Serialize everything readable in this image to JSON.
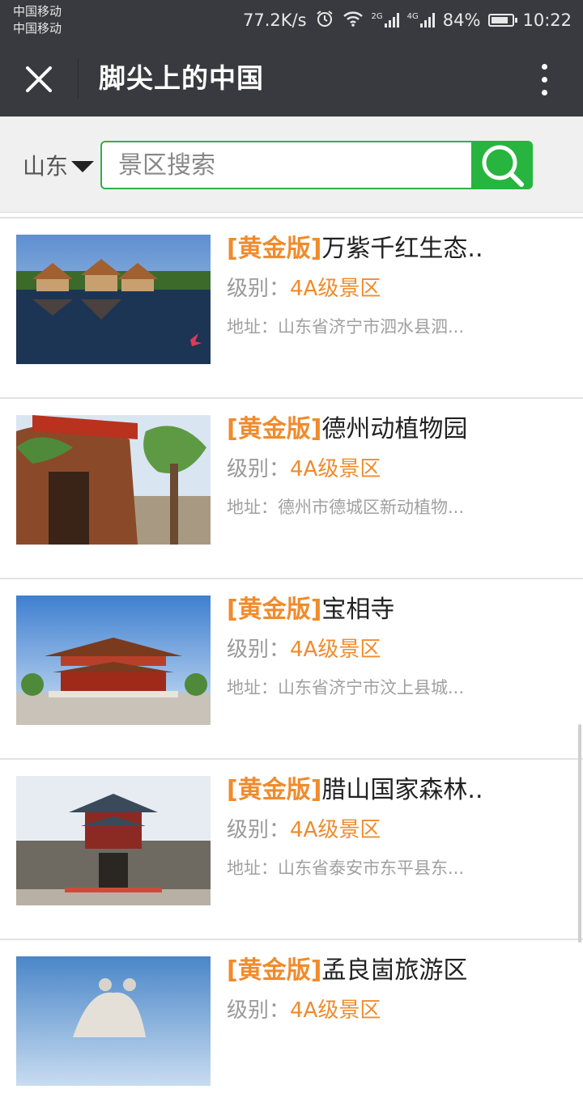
{
  "status_bar": {
    "carrier_1": "中国移动",
    "carrier_2": "中国移动",
    "net_speed": "77.2K/s",
    "net_2g": "2G",
    "net_4g": "4G",
    "battery": "84%",
    "battery_level": 0.84,
    "time": "10:22"
  },
  "header": {
    "title": "脚尖上的中国"
  },
  "search": {
    "region": "山东",
    "placeholder": "景区搜索",
    "value": ""
  },
  "colors": {
    "accent_orange": "#f08b2c",
    "search_green": "#28b53f",
    "header_bg": "#393a3f"
  },
  "list": {
    "level_label": "级别：",
    "address_label": "地址：",
    "tag": "[黄金版]",
    "items": [
      {
        "name": "万紫千红生态..",
        "level": "4A级景区",
        "address": "山东省济宁市泗水县泗..."
      },
      {
        "name": "德州动植物园",
        "level": "4A级景区",
        "address": "德州市德城区新动植物..."
      },
      {
        "name": "宝相寺",
        "level": "4A级景区",
        "address": "山东省济宁市汶上县城..."
      },
      {
        "name": "腊山国家森林..",
        "level": "4A级景区",
        "address": "山东省泰安市东平县东..."
      },
      {
        "name": "孟良崮旅游区",
        "level": "4A级景区",
        "address": ""
      }
    ]
  }
}
